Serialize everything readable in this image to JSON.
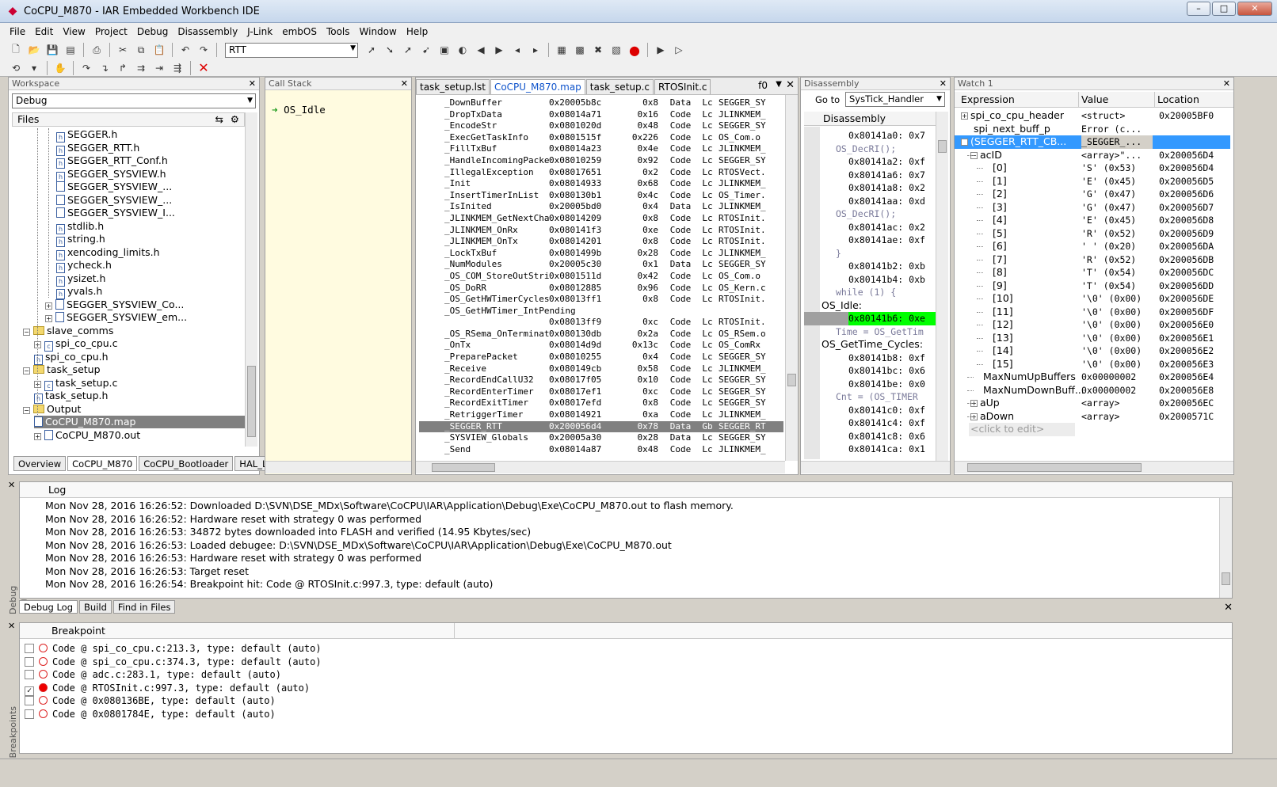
{
  "window": {
    "title": "CoCPU_M870 - IAR Embedded Workbench IDE"
  },
  "menu": [
    "File",
    "Edit",
    "View",
    "Project",
    "Debug",
    "Disassembly",
    "J-Link",
    "embOS",
    "Tools",
    "Window",
    "Help"
  ],
  "toolbar": {
    "search_value": "RTT"
  },
  "workspace": {
    "header": "Workspace",
    "config": "Debug",
    "files_label": "Files",
    "items": [
      {
        "label": "SEGGER.h",
        "type": "file"
      },
      {
        "label": "SEGGER_RTT.h",
        "type": "file"
      },
      {
        "label": "SEGGER_RTT_Conf.h",
        "type": "file"
      },
      {
        "label": "SEGGER_SYSVIEW.h",
        "type": "file"
      },
      {
        "label": "SEGGER_SYSVIEW_...",
        "type": "file"
      },
      {
        "label": "SEGGER_SYSVIEW_...",
        "type": "file"
      },
      {
        "label": "SEGGER_SYSVIEW_I...",
        "type": "file"
      },
      {
        "label": "stdlib.h",
        "type": "file"
      },
      {
        "label": "string.h",
        "type": "file"
      },
      {
        "label": "xencoding_limits.h",
        "type": "file"
      },
      {
        "label": "ycheck.h",
        "type": "file"
      },
      {
        "label": "ysizet.h",
        "type": "file"
      },
      {
        "label": "yvals.h",
        "type": "file"
      },
      {
        "label": "SEGGER_SYSVIEW_Co...",
        "type": "file"
      },
      {
        "label": "SEGGER_SYSVIEW_em...",
        "type": "file"
      },
      {
        "label": "slave_comms",
        "type": "folder"
      },
      {
        "label": "spi_co_cpu.c",
        "type": "file"
      },
      {
        "label": "spi_co_cpu.h",
        "type": "file"
      },
      {
        "label": "task_setup",
        "type": "folder"
      },
      {
        "label": "task_setup.c",
        "type": "file"
      },
      {
        "label": "task_setup.h",
        "type": "file"
      },
      {
        "label": "Output",
        "type": "folder"
      },
      {
        "label": "CoCPU_M870.map",
        "type": "file"
      },
      {
        "label": "CoCPU_M870.out",
        "type": "file"
      }
    ],
    "tabs": [
      "Overview",
      "CoCPU_M870",
      "CoCPU_Bootloader",
      "HAL_Lib"
    ]
  },
  "callstack": {
    "header": "Call Stack",
    "frame": "OS_Idle"
  },
  "editor": {
    "tabs": [
      "task_setup.lst",
      "CoCPU_M870.map",
      "task_setup.c",
      "RTOSInit.c"
    ],
    "tab_menu": "f0",
    "rows": [
      [
        "_DownBuffer",
        "0x20005b8c",
        "0x8",
        "Data",
        "Lc",
        "SEGGER_SY"
      ],
      [
        "_DropTxData",
        "0x08014a71",
        "0x16",
        "Code",
        "Lc",
        "JLINKMEM_"
      ],
      [
        "_EncodeStr",
        "0x0801020d",
        "0x48",
        "Code",
        "Lc",
        "SEGGER_SY"
      ],
      [
        "_ExecGetTaskInfo",
        "0x0801515f",
        "0x226",
        "Code",
        "Lc",
        "OS_Com.o"
      ],
      [
        "_FillTxBuf",
        "0x08014a23",
        "0x4e",
        "Code",
        "Lc",
        "JLINKMEM_"
      ],
      [
        "_HandleIncomingPacket",
        "0x08010259",
        "0x92",
        "Code",
        "Lc",
        "SEGGER_SY"
      ],
      [
        "_IllegalException",
        "0x08017651",
        "0x2",
        "Code",
        "Lc",
        "RTOSVect."
      ],
      [
        "_Init",
        "0x08014933",
        "0x68",
        "Code",
        "Lc",
        "JLINKMEM_"
      ],
      [
        "_InsertTimerInList",
        "0x080130b1",
        "0x4c",
        "Code",
        "Lc",
        "OS_Timer."
      ],
      [
        "_IsInited",
        "0x20005bd0",
        "0x4",
        "Data",
        "Lc",
        "JLINKMEM_"
      ],
      [
        "_JLINKMEM_GetNextChar",
        "0x08014209",
        "0x8",
        "Code",
        "Lc",
        "RTOSInit."
      ],
      [
        "_JLINKMEM_OnRx",
        "0x080141f3",
        "0xe",
        "Code",
        "Lc",
        "RTOSInit."
      ],
      [
        "_JLINKMEM_OnTx",
        "0x08014201",
        "0x8",
        "Code",
        "Lc",
        "RTOSInit."
      ],
      [
        "_LockTxBuf",
        "0x0801499b",
        "0x28",
        "Code",
        "Lc",
        "JLINKMEM_"
      ],
      [
        "_NumModules",
        "0x20005c30",
        "0x1",
        "Data",
        "Lc",
        "SEGGER_SY"
      ],
      [
        "_OS_COM_StoreOutString",
        "0x0801511d",
        "0x42",
        "Code",
        "Lc",
        "OS_Com.o"
      ],
      [
        "_OS_DoRR",
        "0x08012885",
        "0x96",
        "Code",
        "Lc",
        "OS_Kern.c"
      ],
      [
        "_OS_GetHWTimerCycles",
        "0x08013ff1",
        "0x8",
        "Code",
        "Lc",
        "RTOSInit."
      ],
      [
        "_OS_GetHWTimer_IntPending",
        "",
        "",
        "",
        "",
        ""
      ],
      [
        "",
        "0x08013ff9",
        "0xc",
        "Code",
        "Lc",
        "RTOSInit."
      ],
      [
        "_OS_RSema_OnTerminate",
        "0x080130db",
        "0x2a",
        "Code",
        "Lc",
        "OS_RSem.o"
      ],
      [
        "_OnTx",
        "0x08014d9d",
        "0x13c",
        "Code",
        "Lc",
        "OS_ComRx"
      ],
      [
        "_PreparePacket",
        "0x08010255",
        "0x4",
        "Code",
        "Lc",
        "SEGGER_SY"
      ],
      [
        "_Receive",
        "0x080149cb",
        "0x58",
        "Code",
        "Lc",
        "JLINKMEM_"
      ],
      [
        "_RecordEndCallU32",
        "0x08017f05",
        "0x10",
        "Code",
        "Lc",
        "SEGGER_SY"
      ],
      [
        "_RecordEnterTimer",
        "0x08017ef1",
        "0xc",
        "Code",
        "Lc",
        "SEGGER_SY"
      ],
      [
        "_RecordExitTimer",
        "0x08017efd",
        "0x8",
        "Code",
        "Lc",
        "SEGGER_SY"
      ],
      [
        "_RetriggerTimer",
        "0x08014921",
        "0xa",
        "Code",
        "Lc",
        "JLINKMEM_"
      ],
      [
        "_SEGGER_RTT",
        "0x200056d4",
        "0x78",
        "Data",
        "Gb",
        "SEGGER_RT"
      ],
      [
        "_SYSVIEW_Globals",
        "0x20005a30",
        "0x28",
        "Data",
        "Lc",
        "SEGGER_SY"
      ],
      [
        "_Send",
        "0x08014a87",
        "0x48",
        "Code",
        "Lc",
        "JLINKMEM_"
      ],
      [
        "_SendPacket",
        "0x0801038d",
        "0x134",
        "Code",
        "Lc",
        "SEGGER_SY"
      ]
    ]
  },
  "disassembly": {
    "header": "Disassembly",
    "goto_label": "Go to",
    "goto_value": "SysTick_Handler",
    "title": "Disassembly",
    "rows": [
      {
        "t": "addr",
        "text": "0x80141a0: 0x7"
      },
      {
        "t": "src",
        "text": "OS_DecRI();"
      },
      {
        "t": "addr",
        "text": "0x80141a2: 0xf"
      },
      {
        "t": "addr",
        "text": "0x80141a6: 0x7"
      },
      {
        "t": "addr",
        "text": "0x80141a8: 0x2"
      },
      {
        "t": "addr",
        "text": "0x80141aa: 0xd"
      },
      {
        "t": "src",
        "text": "OS_DecRI();"
      },
      {
        "t": "addr",
        "text": "0x80141ac: 0x2"
      },
      {
        "t": "addr",
        "text": "0x80141ae: 0xf"
      },
      {
        "t": "src",
        "text": "}"
      },
      {
        "t": "addr",
        "text": "0x80141b2: 0xb"
      },
      {
        "t": "addr",
        "text": "0x80141b4: 0xb"
      },
      {
        "t": "src",
        "text": "while (1) {"
      },
      {
        "t": "lbl",
        "text": "OS_Idle:"
      },
      {
        "t": "cur",
        "text": "0x80141b6: 0xe"
      },
      {
        "t": "src",
        "text": "Time = OS_GetTim"
      },
      {
        "t": "lbl",
        "text": "OS_GetTime_Cycles:"
      },
      {
        "t": "addr",
        "text": "0x80141b8: 0xf"
      },
      {
        "t": "addr",
        "text": "0x80141bc: 0x6"
      },
      {
        "t": "addr",
        "text": "0x80141be: 0x0"
      },
      {
        "t": "src",
        "text": "Cnt  = (OS_TIMER"
      },
      {
        "t": "addr",
        "text": "0x80141c0: 0xf"
      },
      {
        "t": "addr",
        "text": "0x80141c4: 0xf"
      },
      {
        "t": "addr",
        "text": "0x80141c8: 0x6"
      },
      {
        "t": "addr",
        "text": "0x80141ca: 0x1"
      }
    ]
  },
  "watch": {
    "header": "Watch 1",
    "columns": [
      "Expression",
      "Value",
      "Location"
    ],
    "rows": [
      {
        "e": "spi_co_cpu_header",
        "v": "<struct>",
        "l": "0x20005BF0",
        "ind": 0,
        "pm": "+"
      },
      {
        "e": "spi_next_buff_p",
        "v": "Error (c...",
        "l": "",
        "ind": 0,
        "pm": ""
      },
      {
        "e": "(SEGGER_RTT_CB...",
        "v": "_SEGGER_...",
        "l": "",
        "ind": 0,
        "pm": "-",
        "sel": true
      },
      {
        "e": "acID",
        "v": "<array>\"...",
        "l": "0x200056D4",
        "ind": 1,
        "pm": "-"
      },
      {
        "e": "[0]",
        "v": "'S' (0x53)",
        "l": "0x200056D4",
        "ind": 2,
        "pm": ""
      },
      {
        "e": "[1]",
        "v": "'E' (0x45)",
        "l": "0x200056D5",
        "ind": 2,
        "pm": ""
      },
      {
        "e": "[2]",
        "v": "'G' (0x47)",
        "l": "0x200056D6",
        "ind": 2,
        "pm": ""
      },
      {
        "e": "[3]",
        "v": "'G' (0x47)",
        "l": "0x200056D7",
        "ind": 2,
        "pm": ""
      },
      {
        "e": "[4]",
        "v": "'E' (0x45)",
        "l": "0x200056D8",
        "ind": 2,
        "pm": ""
      },
      {
        "e": "[5]",
        "v": "'R' (0x52)",
        "l": "0x200056D9",
        "ind": 2,
        "pm": ""
      },
      {
        "e": "[6]",
        "v": "' ' (0x20)",
        "l": "0x200056DA",
        "ind": 2,
        "pm": ""
      },
      {
        "e": "[7]",
        "v": "'R' (0x52)",
        "l": "0x200056DB",
        "ind": 2,
        "pm": ""
      },
      {
        "e": "[8]",
        "v": "'T' (0x54)",
        "l": "0x200056DC",
        "ind": 2,
        "pm": ""
      },
      {
        "e": "[9]",
        "v": "'T' (0x54)",
        "l": "0x200056DD",
        "ind": 2,
        "pm": ""
      },
      {
        "e": "[10]",
        "v": "'\\0' (0x00)",
        "l": "0x200056DE",
        "ind": 2,
        "pm": ""
      },
      {
        "e": "[11]",
        "v": "'\\0' (0x00)",
        "l": "0x200056DF",
        "ind": 2,
        "pm": ""
      },
      {
        "e": "[12]",
        "v": "'\\0' (0x00)",
        "l": "0x200056E0",
        "ind": 2,
        "pm": ""
      },
      {
        "e": "[13]",
        "v": "'\\0' (0x00)",
        "l": "0x200056E1",
        "ind": 2,
        "pm": ""
      },
      {
        "e": "[14]",
        "v": "'\\0' (0x00)",
        "l": "0x200056E2",
        "ind": 2,
        "pm": ""
      },
      {
        "e": "[15]",
        "v": "'\\0' (0x00)",
        "l": "0x200056E3",
        "ind": 2,
        "pm": ""
      },
      {
        "e": "MaxNumUpBuffers",
        "v": "0x00000002",
        "l": "0x200056E4",
        "ind": 1,
        "pm": ""
      },
      {
        "e": "MaxNumDownBuff...",
        "v": "0x00000002",
        "l": "0x200056E8",
        "ind": 1,
        "pm": ""
      },
      {
        "e": "aUp",
        "v": "<array>",
        "l": "0x200056EC",
        "ind": 1,
        "pm": "+"
      },
      {
        "e": "aDown",
        "v": "<array>",
        "l": "0x2000571C",
        "ind": 1,
        "pm": "+"
      }
    ],
    "click_to_edit": "<click to edit>"
  },
  "log": {
    "column": "Log",
    "lines": [
      "Mon Nov 28, 2016 16:26:52: Downloaded D:\\SVN\\DSE_MDx\\Software\\CoCPU\\IAR\\Application\\Debug\\Exe\\CoCPU_M870.out to flash memory.",
      "Mon Nov 28, 2016 16:26:52: Hardware reset with strategy 0 was performed",
      "Mon Nov 28, 2016 16:26:53: 34872 bytes downloaded into FLASH and verified (14.95 Kbytes/sec)",
      "Mon Nov 28, 2016 16:26:53: Loaded debugee: D:\\SVN\\DSE_MDx\\Software\\CoCPU\\IAR\\Application\\Debug\\Exe\\CoCPU_M870.out",
      "Mon Nov 28, 2016 16:26:53: Hardware reset with strategy 0 was performed",
      "Mon Nov 28, 2016 16:26:53: Target reset",
      "Mon Nov 28, 2016 16:26:54: Breakpoint hit: Code @ RTOSInit.c:997.3, type: default (auto)"
    ],
    "tabs": [
      "Debug Log",
      "Build",
      "Find in Files"
    ],
    "side_label": "Debug Log"
  },
  "breakpoints": {
    "column": "Breakpoint",
    "side_label": "Breakpoints",
    "rows": [
      {
        "text": "Code @ spi_co_cpu.c:213.3, type: default (auto)",
        "checked": false,
        "active": false
      },
      {
        "text": "Code @ spi_co_cpu.c:374.3, type: default (auto)",
        "checked": false,
        "active": false
      },
      {
        "text": "Code @ adc.c:283.1, type: default (auto)",
        "checked": false,
        "active": false
      },
      {
        "text": "Code @ RTOSInit.c:997.3, type: default (auto)",
        "checked": true,
        "active": true
      },
      {
        "text": "Code @ 0x080136BE, type: default (auto)",
        "checked": false,
        "active": false
      },
      {
        "text": "Code @ 0x0801784E, type: default (auto)",
        "checked": false,
        "active": false
      }
    ]
  },
  "colors": {
    "current_line": "#00ff00",
    "selection": "#3399ff",
    "callstack_bg": "#fffbe0"
  }
}
